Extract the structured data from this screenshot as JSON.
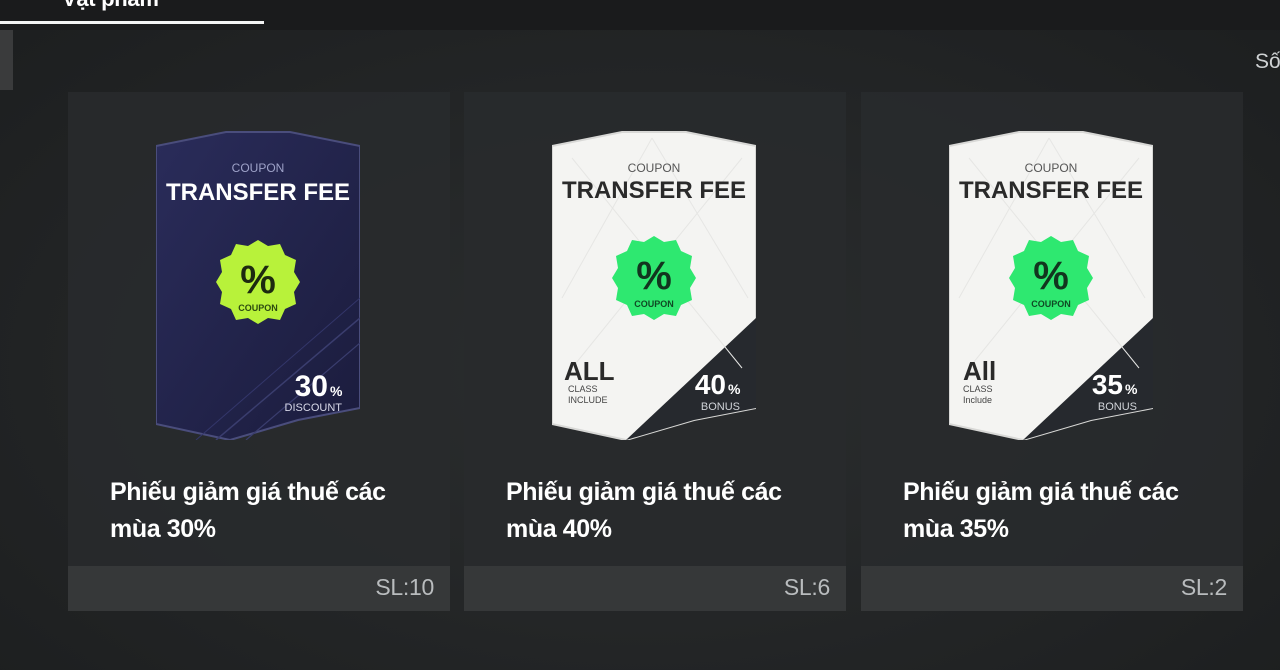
{
  "tabs": {
    "active_label": "Vật phẩm"
  },
  "sort": {
    "label": "Số"
  },
  "items": [
    {
      "coupon_small": "COUPON",
      "coupon_big": "TRANSFER FEE",
      "badge_symbol": "%",
      "badge_text": "COUPON",
      "value": "30",
      "value_unit": "%",
      "value_caption": "DISCOUNT",
      "class_big": "",
      "class_line1": "",
      "class_line2": "",
      "title": "Phiếu giảm giá thuế các mùa 30%",
      "quantity": "SL:10",
      "style": "dark",
      "badge_color": "#b8f23a"
    },
    {
      "coupon_small": "COUPON",
      "coupon_big": "TRANSFER FEE",
      "badge_symbol": "%",
      "badge_text": "COUPON",
      "value": "40",
      "value_unit": "%",
      "value_caption": "BONUS",
      "class_big": "ALL",
      "class_line1": "CLASS",
      "class_line2": "INCLUDE",
      "title": "Phiếu giảm giá thuế các mùa 40%",
      "quantity": "SL:6",
      "style": "light",
      "badge_color": "#2ee870"
    },
    {
      "coupon_small": "COUPON",
      "coupon_big": "TRANSFER FEE",
      "badge_symbol": "%",
      "badge_text": "COUPON",
      "value": "35",
      "value_unit": "%",
      "value_caption": "BONUS",
      "class_big": "All",
      "class_line1": "CLASS",
      "class_line2": "Include",
      "title": "Phiếu giảm giá thuế các mùa 35%",
      "quantity": "SL:2",
      "style": "light",
      "badge_color": "#2ee870"
    }
  ]
}
